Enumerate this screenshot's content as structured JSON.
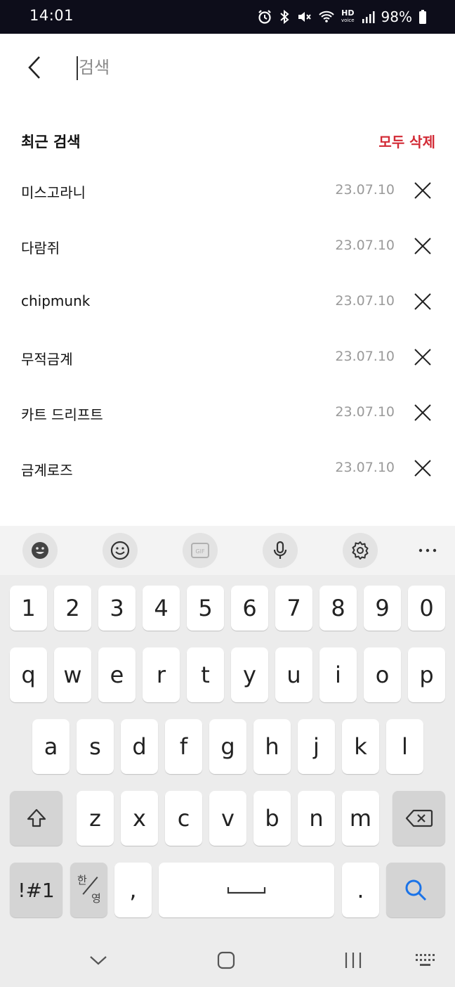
{
  "status_bar": {
    "time": "14:01",
    "hd": "HD",
    "hd_sub": "voice",
    "battery": "98%",
    "icons": [
      "alarm-icon",
      "bluetooth-icon",
      "mute-icon",
      "wifi-icon",
      "signal-icon",
      "battery-icon"
    ]
  },
  "search": {
    "placeholder": "검색",
    "value": ""
  },
  "recent": {
    "title": "최근 검색",
    "delete_all": "모두 삭제",
    "accent_color": "#d22a35",
    "items": [
      {
        "term": "미스고라니",
        "date": "23.07.10"
      },
      {
        "term": "다람쥐",
        "date": "23.07.10"
      },
      {
        "term": "chipmunk",
        "date": "23.07.10"
      },
      {
        "term": "무적금계",
        "date": "23.07.10"
      },
      {
        "term": "카트 드리프트",
        "date": "23.07.10"
      },
      {
        "term": "금계로즈",
        "date": "23.07.10"
      }
    ]
  },
  "keyboard": {
    "toolbar": [
      "expression-icon",
      "emoji-icon",
      "gif-icon",
      "microphone-icon",
      "settings-icon",
      "more-icon"
    ],
    "gif_label": "GIF",
    "row_numbers": [
      "1",
      "2",
      "3",
      "4",
      "5",
      "6",
      "7",
      "8",
      "9",
      "0"
    ],
    "row1": [
      "q",
      "w",
      "e",
      "r",
      "t",
      "y",
      "u",
      "i",
      "o",
      "p"
    ],
    "row2": [
      "a",
      "s",
      "d",
      "f",
      "g",
      "h",
      "j",
      "k",
      "l"
    ],
    "row3": [
      "z",
      "x",
      "c",
      "v",
      "b",
      "n",
      "m"
    ],
    "symbols": "!#1",
    "lang_top": "한",
    "lang_bottom": "영",
    "comma": ",",
    "period": ".",
    "search_icon_color": "#1a73e8"
  }
}
